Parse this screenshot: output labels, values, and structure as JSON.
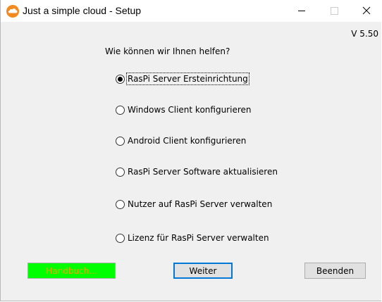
{
  "window": {
    "title": "Just a simple cloud - Setup",
    "app_icon": "cloud-icon",
    "controls": {
      "minimize": "minimize-icon",
      "maximize": "maximize-icon",
      "close": "close-icon"
    }
  },
  "version": "V 5.50",
  "question": "Wie können wir Ihnen helfen?",
  "options": [
    {
      "label": "RasPi Server Ersteinrichtung",
      "checked": true
    },
    {
      "label": "Windows Client konfigurieren",
      "checked": false
    },
    {
      "label": "Android Client konfigurieren",
      "checked": false
    },
    {
      "label": "RasPi Server Software aktualisieren",
      "checked": false
    },
    {
      "label": "Nutzer auf RasPi Server verwalten",
      "checked": false
    },
    {
      "label": "Lizenz für RasPi Server verwalten",
      "checked": false
    }
  ],
  "buttons": {
    "help": "Handbuch...",
    "next": "Weiter",
    "quit": "Beenden"
  },
  "colors": {
    "help_bg": "#00ff00",
    "help_text": "#e8a800",
    "focus_border": "#0078d7",
    "icon_orange": "#f28a1e"
  }
}
